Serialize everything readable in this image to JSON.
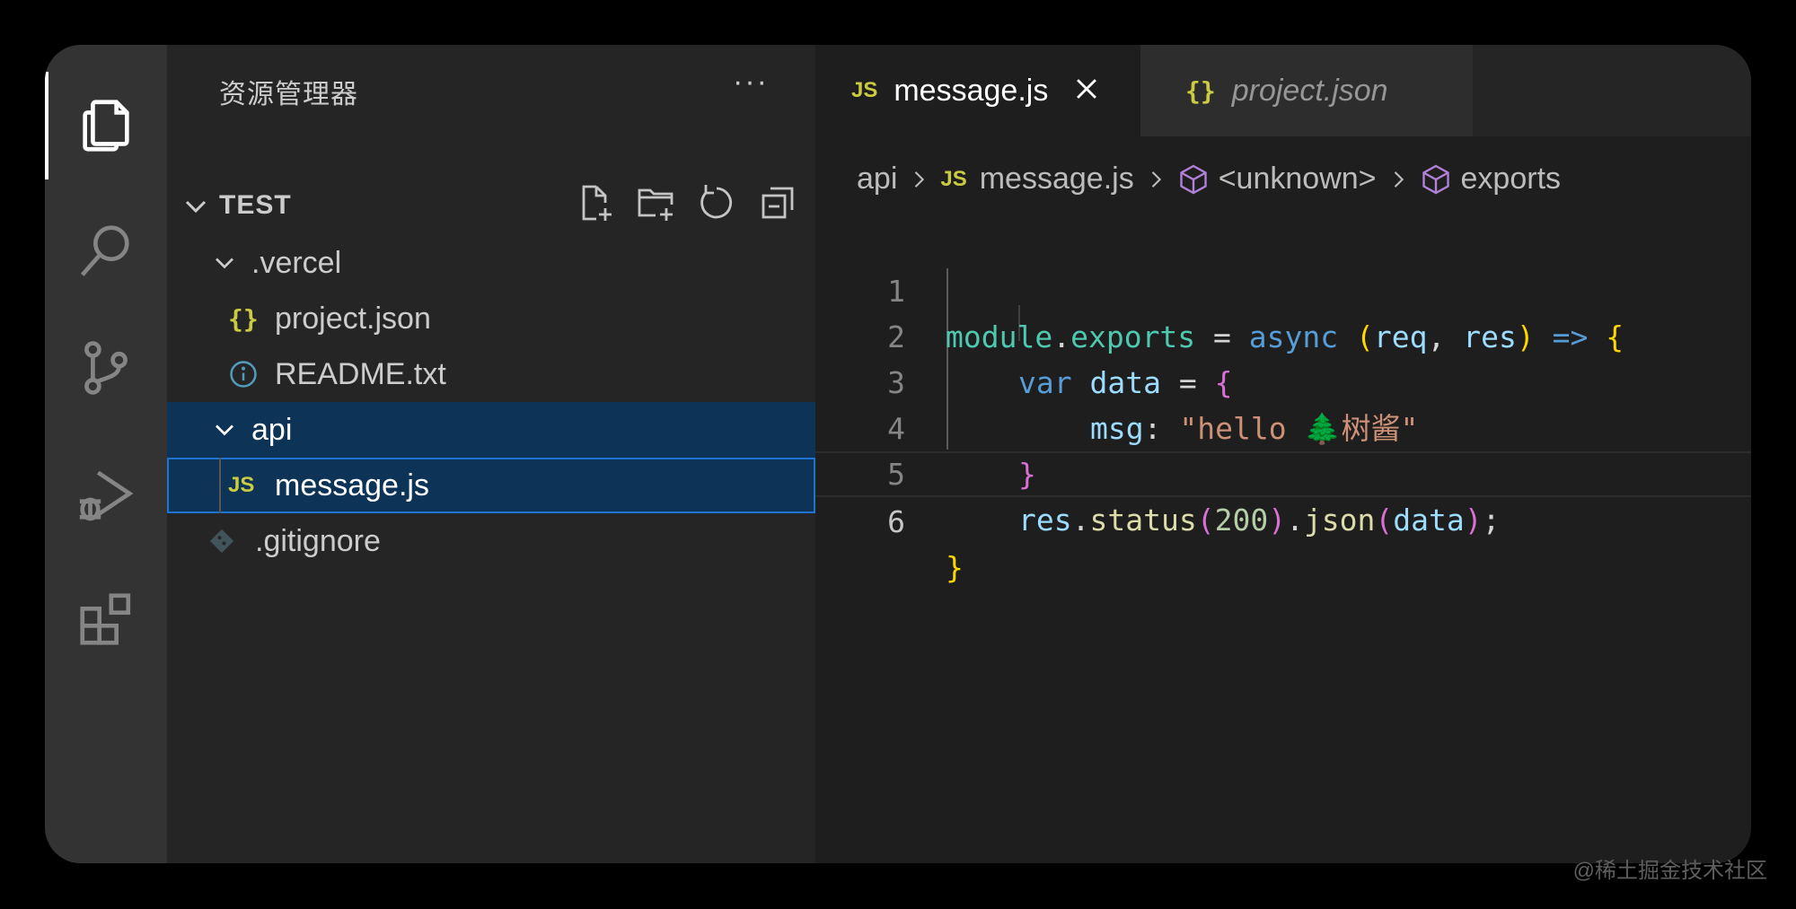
{
  "explorer": {
    "title": "资源管理器",
    "more": "···",
    "section": "TEST",
    "tree": [
      {
        "label": ".vercel",
        "icon": "chevron-down-icon"
      },
      {
        "label": "project.json",
        "icon": "json-file-icon",
        "icon_text": "{}"
      },
      {
        "label": "README.txt",
        "icon": "info-icon"
      },
      {
        "label": "api",
        "icon": "chevron-down-icon"
      },
      {
        "label": "message.js",
        "icon": "js-file-icon",
        "icon_text": "JS"
      },
      {
        "label": ".gitignore",
        "icon": "git-icon"
      }
    ]
  },
  "tabs": [
    {
      "label": "message.js",
      "icon_text": "JS",
      "active": true
    },
    {
      "label": "project.json",
      "icon_text": "{}",
      "active": false
    }
  ],
  "breadcrumb": {
    "folder": "api",
    "file_icon": "JS",
    "file": "message.js",
    "symbol1": "<unknown>",
    "symbol2": "exports"
  },
  "code": {
    "line_numbers": [
      "1",
      "2",
      "3",
      "4",
      "5",
      "6"
    ],
    "l1": {
      "module": "module",
      "dot": ".",
      "exports": "exports",
      "eq": " = ",
      "async": "async",
      "sp": " ",
      "lp": "(",
      "req": "req",
      "comma": ", ",
      "res": "res",
      "rp": ")",
      "arrow": " => ",
      "lb": "{"
    },
    "l2": {
      "var": "var",
      "data": " data",
      "eq": " = ",
      "lb": "{"
    },
    "l3": {
      "key": "msg",
      "colon": ": ",
      "str": "\"hello 🌲树酱\""
    },
    "l4": {
      "rb": "}"
    },
    "l5": {
      "res": "res",
      "dot1": ".",
      "status": "status",
      "lp1": "(",
      "num": "200",
      "rp1": ")",
      "dot2": ".",
      "json": "json",
      "lp2": "(",
      "data": "data",
      "rp2": ")",
      "semi": ";"
    },
    "l6": {
      "rb": "}"
    }
  },
  "watermark": "@稀土掘金技术社区",
  "colors": {
    "background": "#1e1e1e",
    "sidebar": "#252526",
    "activity_bar": "#333333",
    "selection": "#0d3357",
    "focus_border": "#1f73d1",
    "js_yellow": "#cbcb41"
  }
}
